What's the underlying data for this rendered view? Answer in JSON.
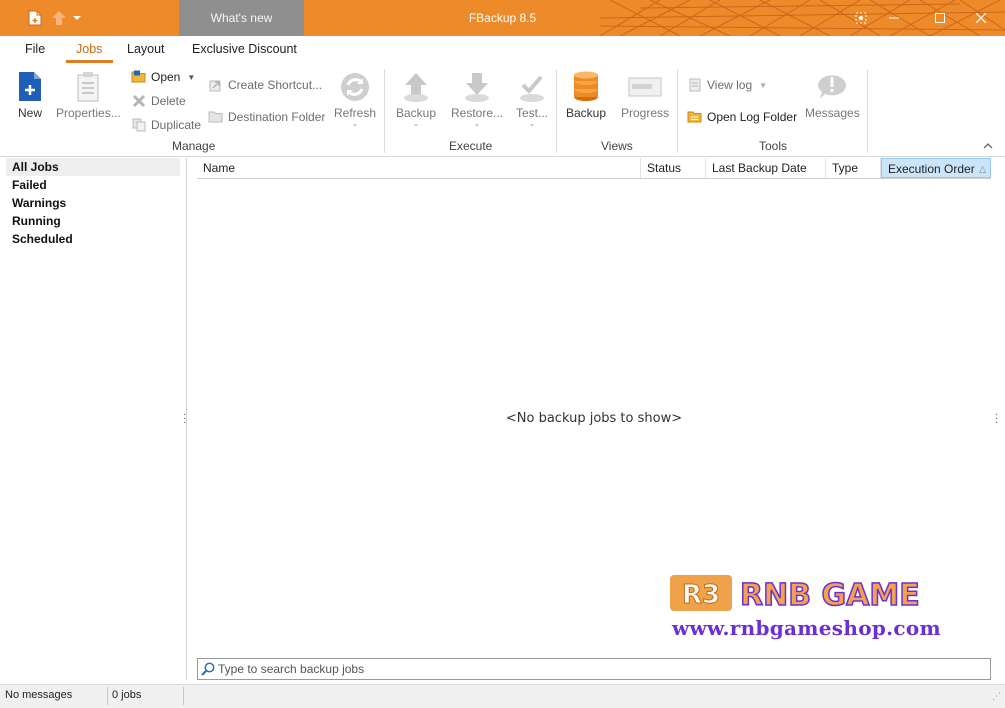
{
  "window": {
    "title": "FBackup 8.5",
    "whats_new_label": "What's new"
  },
  "tabs": [
    {
      "label": "File"
    },
    {
      "label": "Jobs"
    },
    {
      "label": "Layout"
    },
    {
      "label": "Exclusive Discount"
    }
  ],
  "ribbon": {
    "manage": {
      "group_label": "Manage",
      "new": "New",
      "properties": "Properties...",
      "open": "Open",
      "delete": "Delete",
      "duplicate": "Duplicate",
      "create_shortcut": "Create Shortcut...",
      "destination_folder": "Destination Folder",
      "refresh": "Refresh"
    },
    "execute": {
      "group_label": "Execute",
      "backup": "Backup",
      "restore": "Restore...",
      "test": "Test..."
    },
    "views": {
      "group_label": "Views",
      "backup": "Backup",
      "progress": "Progress"
    },
    "tools": {
      "group_label": "Tools",
      "view_log": "View log",
      "open_log_folder": "Open Log Folder",
      "messages": "Messages"
    }
  },
  "sidebar": {
    "items": [
      {
        "label": "All Jobs"
      },
      {
        "label": "Failed"
      },
      {
        "label": "Warnings"
      },
      {
        "label": "Running"
      },
      {
        "label": "Scheduled"
      }
    ]
  },
  "grid": {
    "columns": [
      {
        "label": "Name"
      },
      {
        "label": "Status"
      },
      {
        "label": "Last Backup Date"
      },
      {
        "label": "Type"
      },
      {
        "label": "Execution Order"
      }
    ],
    "empty_message": "<No backup jobs to show>"
  },
  "search": {
    "placeholder": "Type to search backup jobs"
  },
  "statusbar": {
    "messages": "No messages",
    "jobs": "0 jobs"
  },
  "watermark": {
    "logo_text": "RNB GAME",
    "url": "www.rnbgameshop.com"
  },
  "colors": {
    "title_bar": "#ed8a2a",
    "accent": "#e27c20",
    "watermark_purple": "#6a30d6"
  },
  "icons": {
    "new": "new-document-icon",
    "properties": "properties-icon",
    "open": "folder-open-icon",
    "delete": "delete-icon",
    "duplicate": "duplicate-icon",
    "refresh": "refresh-icon",
    "backup": "upload-arrow-icon",
    "restore": "download-arrow-icon",
    "test": "test-icon",
    "views_backup": "database-icon",
    "progress": "progress-icon",
    "messages": "messages-icon"
  }
}
